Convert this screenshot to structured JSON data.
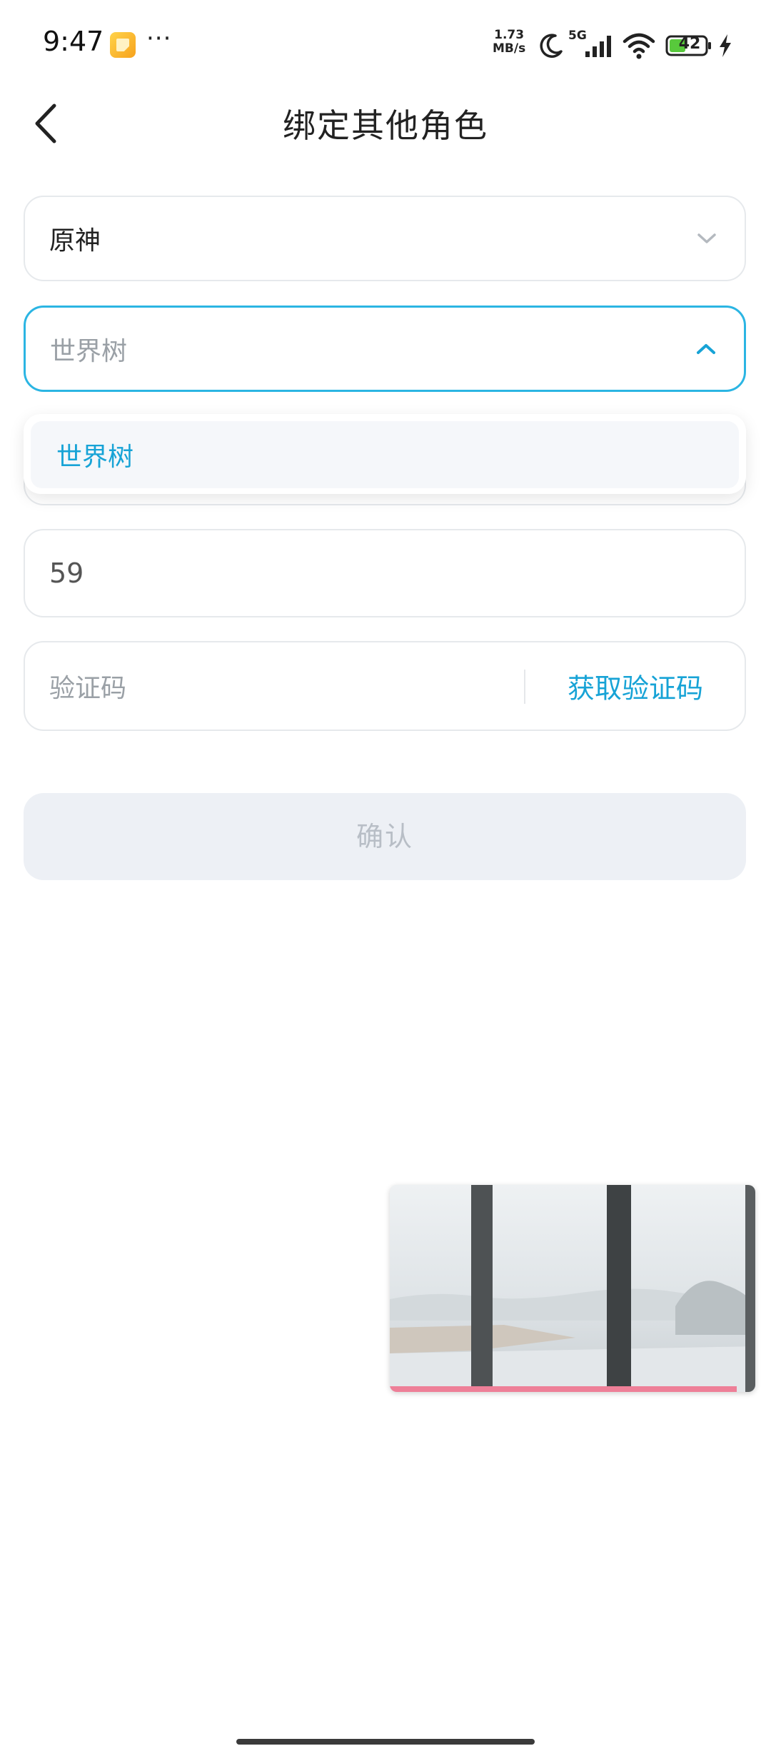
{
  "status_bar": {
    "time": "9:47",
    "more": "···",
    "net_speed_value": "1.73",
    "net_speed_unit": "MB/s",
    "network": "5G",
    "battery": "42",
    "icons": [
      "notification-app-icon",
      "moon-icon",
      "signal-icon",
      "wifi-icon",
      "battery-icon",
      "charging-icon"
    ]
  },
  "header": {
    "title": "绑定其他角色",
    "back_icon": "chevron-left-icon"
  },
  "form": {
    "game_select": {
      "value": "原神",
      "icon": "chevron-down-icon"
    },
    "server_select": {
      "placeholder": "世界树",
      "icon": "chevron-up-icon",
      "expanded": true
    },
    "server_options": [
      "世界树"
    ],
    "uid_value": "59",
    "code_placeholder": "验证码",
    "get_code_label": "获取验证码",
    "confirm_label": "确认"
  },
  "video": {
    "progress_fraction": 0.95
  },
  "colors": {
    "accent": "#17a3d6",
    "focus_border": "#2bb5e3",
    "disabled_bg": "#edf0f5",
    "progress": "#ee7f98"
  }
}
